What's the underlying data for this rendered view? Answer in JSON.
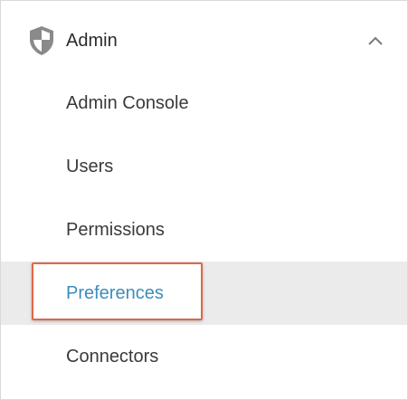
{
  "section": {
    "title": "Admin",
    "icon": "shield-icon",
    "collapse_icon": "chevron-up-icon"
  },
  "items": [
    {
      "label": "Admin Console"
    },
    {
      "label": "Users"
    },
    {
      "label": "Permissions"
    },
    {
      "label": "Preferences",
      "selected": true
    },
    {
      "label": "Connectors"
    }
  ],
  "colors": {
    "selected_text": "#3c8dbc",
    "selected_background": "#ebebeb",
    "highlight_border": "#e0674a",
    "icon": "#8a8a8a"
  }
}
